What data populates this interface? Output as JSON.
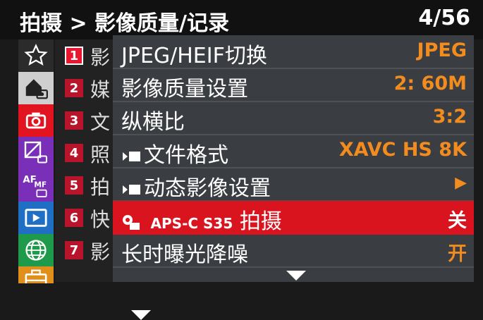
{
  "header": {
    "title": "拍摄 > 影像质量/记录",
    "page": "4/56"
  },
  "sidebar": {
    "items": [
      {
        "icon": "star-icon"
      },
      {
        "icon": "home-camera-icon"
      },
      {
        "icon": "camera-icon"
      },
      {
        "icon": "exposure-icon"
      },
      {
        "icon": "af-mf-icon"
      },
      {
        "icon": "playback-icon"
      },
      {
        "icon": "network-icon"
      },
      {
        "icon": "toolbox-icon"
      }
    ]
  },
  "subpages": [
    {
      "num": "1",
      "text": "影"
    },
    {
      "num": "2",
      "text": "媒"
    },
    {
      "num": "3",
      "text": "文"
    },
    {
      "num": "4",
      "text": "照"
    },
    {
      "num": "5",
      "text": "拍"
    },
    {
      "num": "6",
      "text": "快"
    },
    {
      "num": "7",
      "text": "影"
    }
  ],
  "menu": {
    "rows": [
      {
        "label": "JPEG/HEIF切换",
        "value": "JPEG"
      },
      {
        "label": "影像质量设置",
        "value": "2: 60M"
      },
      {
        "label": "纵横比",
        "value": "3:2"
      },
      {
        "label": "文件格式",
        "value": "XAVC HS 8K"
      },
      {
        "label": "动态影像设置",
        "value": "▶"
      },
      {
        "label_prefix": "APS-C S35",
        "label": "拍摄",
        "value": "关"
      },
      {
        "label": "长时曝光降噪",
        "value": "开"
      }
    ]
  },
  "colors": {
    "accent": "#d9141f",
    "value": "#f28c1e",
    "panel": "#3a3d41"
  }
}
